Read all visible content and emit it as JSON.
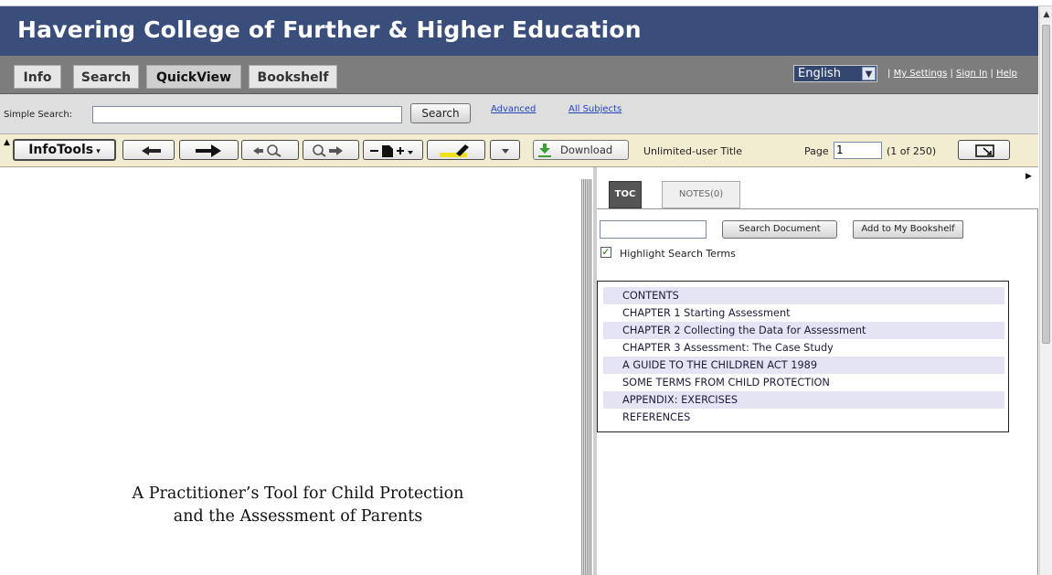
{
  "header": {
    "title": "Havering College of Further & Higher Education"
  },
  "nav": {
    "tabs": [
      {
        "label": "Info",
        "active": false
      },
      {
        "label": "Search",
        "active": false
      },
      {
        "label": "QuickView",
        "active": true
      },
      {
        "label": "Bookshelf",
        "active": false
      }
    ],
    "language": "English",
    "links": {
      "my_settings": "My Settings",
      "sign_in": "Sign In",
      "help": "Help"
    }
  },
  "search": {
    "label": "Simple Search:",
    "value": "",
    "button": "Search",
    "advanced": "Advanced",
    "all_subjects": "All Subjects"
  },
  "toolbar": {
    "infotools": "InfoTools",
    "download": "Download",
    "license": "Unlimited-user Title",
    "page_label": "Page",
    "page_value": "1",
    "page_count": "(1 of 250)",
    "icons": [
      "back-arrow-icon",
      "forward-arrow-icon",
      "search-back-icon",
      "search-forward-icon",
      "page-add-icon",
      "highlighter-icon",
      "dropdown-icon",
      "download-icon",
      "fit-page-icon"
    ]
  },
  "document": {
    "title_line1": "A Practitioner’s Tool for Child Protection",
    "title_line2": "and the Assessment of Parents"
  },
  "sidepanel": {
    "tabs": {
      "toc": "TOC",
      "notes": "NOTES(0)"
    },
    "search_value": "",
    "search_button": "Search Document",
    "bookshelf_button": "Add to My Bookshelf",
    "highlight_label": "Highlight Search Terms",
    "highlight_checked": true,
    "toc_items": [
      "CONTENTS",
      "CHAPTER 1 Starting Assessment",
      "CHAPTER 2 Collecting the Data for Assessment",
      "CHAPTER 3 Assessment: The Case Study",
      "A GUIDE TO THE CHILDREN ACT 1989",
      "SOME TERMS FROM CHILD PROTECTION",
      "APPENDIX: EXERCISES",
      "REFERENCES"
    ]
  },
  "colors": {
    "header_bg": "#3a4e7c",
    "nav_bg": "#7d7d7d",
    "toolbar_bg": "#f2ecd0",
    "toc_row_alt": "#e4e4f4"
  }
}
